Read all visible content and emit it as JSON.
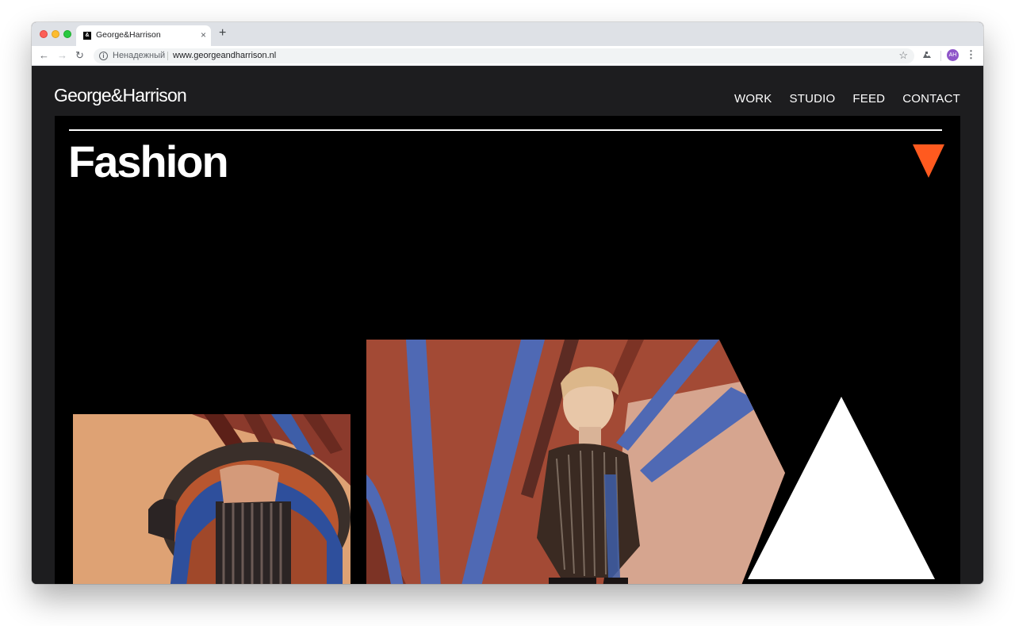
{
  "browser": {
    "tab_title": "George&Harrison",
    "favicon_text": "&",
    "tab_close": "×",
    "new_tab": "+",
    "back": "←",
    "forward": "→",
    "reload": "↻",
    "security_label": "Ненадежный",
    "url": "www.georgeandharrison.nl",
    "star": "☆",
    "avatar_initials": "AH",
    "menu": "⋮"
  },
  "site": {
    "logo": "George&Harrison",
    "nav": [
      "WORK",
      "STUDIO",
      "FEED",
      "CONTACT"
    ]
  },
  "hero": {
    "title": "Fashion"
  },
  "colors": {
    "accent": "#ff5a1f",
    "background": "#1d1d1f",
    "hero_bg": "#000000"
  }
}
